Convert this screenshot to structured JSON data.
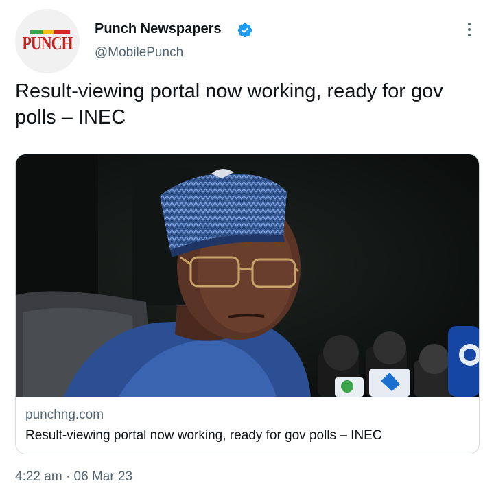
{
  "author": {
    "display_name": "Punch Newspapers",
    "handle": "@MobilePunch",
    "verified": true,
    "avatar_logo_text": "PUNCH"
  },
  "tweet": {
    "text": "Result-viewing portal now working, ready for gov polls – INEC",
    "time": "4:22 am",
    "separator": "·",
    "date": "06 Mar 23"
  },
  "card": {
    "domain": "punchng.com",
    "title": "Result-viewing portal now working, ready for gov polls – INEC",
    "image_icon": "photo-man-in-blue-cap-at-microphones"
  },
  "icons": {
    "more": "more-vertical-icon",
    "verified": "verified-badge-icon"
  },
  "colors": {
    "verified_blue": "#1d9bf0",
    "secondary_text": "#536471",
    "brand_red": "#c8211f"
  }
}
